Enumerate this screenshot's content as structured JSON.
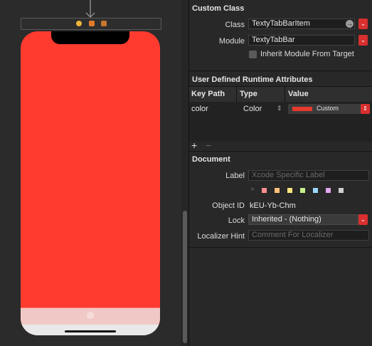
{
  "custom_class": {
    "title": "Custom Class",
    "class_label": "Class",
    "class_value": "TextyTabBarItem",
    "module_label": "Module",
    "module_value": "TextyTabBar",
    "inherit_label": "Inherit Module From Target"
  },
  "runtime_attributes": {
    "title": "User Defined Runtime Attributes",
    "columns": [
      "Key Path",
      "Type",
      "Value"
    ],
    "rows": [
      {
        "key_path": "color",
        "type": "Color",
        "value": "Custom",
        "swatch": "#e8392f"
      }
    ],
    "add_symbol": "+",
    "remove_symbol": "−"
  },
  "document": {
    "title": "Document",
    "label_label": "Label",
    "label_placeholder": "Xcode Specific Label",
    "label_chips": [
      "#ff8f8f",
      "#ffc078",
      "#ffe680",
      "#c7f08b",
      "#9ad6ff",
      "#e1a8f0",
      "#cfcfcf"
    ],
    "object_id_label": "Object ID",
    "object_id_value": "kEU-Yb-Chm",
    "lock_label": "Lock",
    "lock_value": "Inherited - (Nothing)",
    "localizer_label": "Localizer Hint",
    "localizer_placeholder": "Comment For Localizer"
  },
  "colors": {
    "view_background": "#ff3b30",
    "accent_button": "#d92f2f"
  }
}
